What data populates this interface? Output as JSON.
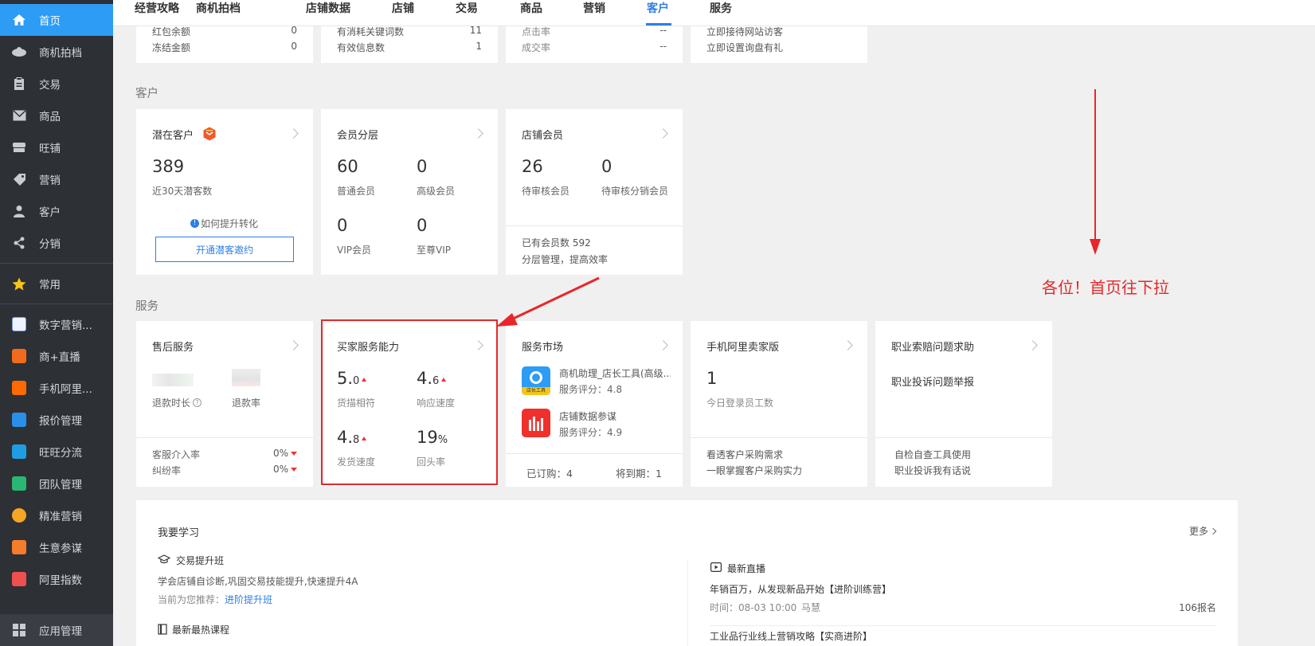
{
  "sidebar": {
    "items": [
      {
        "label": "首页",
        "icon": "home-icon"
      },
      {
        "label": "商机拍档",
        "icon": "handshake-icon"
      },
      {
        "label": "交易",
        "icon": "clipboard-icon"
      },
      {
        "label": "商品",
        "icon": "envelope-icon"
      },
      {
        "label": "旺铺",
        "icon": "store-icon"
      },
      {
        "label": "营销",
        "icon": "tag-icon"
      },
      {
        "label": "客户",
        "icon": "user-icon"
      },
      {
        "label": "分销",
        "icon": "network-icon"
      },
      {
        "label": "常用",
        "icon": "star-icon"
      },
      {
        "label": "数字营销...",
        "icon": "digital-marketing-icon"
      },
      {
        "label": "商+直播",
        "icon": "live-broadcast-icon"
      },
      {
        "label": "手机阿里...",
        "icon": "mobile-ali-icon"
      },
      {
        "label": "报价管理",
        "icon": "quote-icon"
      },
      {
        "label": "旺旺分流",
        "icon": "wangwang-icon"
      },
      {
        "label": "团队管理",
        "icon": "team-icon"
      },
      {
        "label": "精准营销",
        "icon": "target-icon"
      },
      {
        "label": "生意参谋",
        "icon": "compass-icon"
      },
      {
        "label": "阿里指数",
        "icon": "trend-icon"
      },
      {
        "label": "应用管理",
        "icon": "apps-grid-icon"
      }
    ]
  },
  "topnav": {
    "tabs": [
      "经营攻略",
      "商机拍档",
      "店铺数据",
      "店铺",
      "交易",
      "商品",
      "营销",
      "客户",
      "服务"
    ],
    "active": "客户"
  },
  "top_partial": {
    "c1": {
      "r1_label": "红包余额",
      "r1_value": "0",
      "r2_label": "冻结金额",
      "r2_value": "0"
    },
    "c2": {
      "r1_label": "有消耗关键词数",
      "r1_value": "11",
      "r2_label": "有效信息数",
      "r2_value": "1"
    },
    "c3": {
      "r1_label": "点击率",
      "r1_value": "--",
      "r2_label": "成交率",
      "r2_value": "--"
    },
    "c4": {
      "r1": "立即接待网站访客",
      "r2": "立即设置询盘有礼"
    }
  },
  "customer_section": {
    "title": "客户",
    "potential": {
      "title": "潜在客户",
      "value": "389",
      "label": "近30天潜客数",
      "hint": "如何提升转化",
      "button": "开通潜客邀约"
    },
    "member_tier": {
      "title": "会员分层",
      "items": [
        {
          "value": "60",
          "label": "普通会员"
        },
        {
          "value": "0",
          "label": "高级会员"
        },
        {
          "value": "0",
          "label": "VIP会员"
        },
        {
          "value": "0",
          "label": "至尊VIP"
        }
      ]
    },
    "shop_member": {
      "title": "店铺会员",
      "items": [
        {
          "value": "26",
          "label": "待审核会员"
        },
        {
          "value": "0",
          "label": "待审核分销会员"
        }
      ],
      "footer1": "已有会员数 592",
      "footer2": "分层管理，提高效率"
    }
  },
  "service_section": {
    "title": "服务",
    "after_sales": {
      "title": "售后服务",
      "label1": "退款时长",
      "label2": "退款率",
      "row1_label": "客服介入率",
      "row1_value": "0%",
      "row2_label": "纠纷率",
      "row2_value": "0%"
    },
    "buyer_service": {
      "title": "买家服务能力",
      "items": [
        {
          "main": "5.",
          "suffix": "0",
          "label": "货描相符"
        },
        {
          "main": "4.",
          "suffix": "6",
          "label": "响应速度"
        },
        {
          "main": "4.",
          "suffix": "8",
          "label": "发货速度"
        },
        {
          "main": "19",
          "suffix": "%",
          "label": "回头率"
        }
      ]
    },
    "market": {
      "title": "服务市场",
      "apps": [
        {
          "name": "商机助理_店长工具(高级...",
          "rating": "服务评分：4.8",
          "badge": "店长工具"
        },
        {
          "name": "店铺数据参谋",
          "rating": "服务评分：4.9"
        }
      ],
      "subscribed": "已订购：4",
      "expiring": "将到期：1"
    },
    "mobile_seller": {
      "title": "手机阿里卖家版",
      "value": "1",
      "label": "今日登录员工数",
      "footer1": "看透客户采购需求",
      "footer2": "一眼掌握客户采购实力"
    },
    "claims": {
      "title": "职业索赔问题求助",
      "body": "职业投诉问题举报",
      "footer1": "自检自查工具使用",
      "footer2": "职业投诉我有话说"
    }
  },
  "learn": {
    "title": "我要学习",
    "more": "更多",
    "course1": {
      "title": "交易提升班",
      "desc": "学会店铺自诊断,巩固交易技能提升,快速提升4A",
      "recommend_prefix": "当前为您推荐：",
      "recommend_link": "进阶提升班"
    },
    "course2": {
      "title": "最新最热课程"
    },
    "live": {
      "title": "最新直播",
      "item1": "年销百万，从发现新品开始【进阶训练营】",
      "item1_time": "时间：08-03 10:00",
      "item1_host": "马慧",
      "item1_count": "106报名",
      "item2": "工业品行业线上营销攻略【实商进阶】"
    }
  },
  "annotation": {
    "text": "各位！首页往下拉",
    "color": "#e8262a"
  },
  "colors": {
    "accent": "#2d7fe6",
    "sidebar_bg": "#2d3035",
    "sidebar_active": "#2d9cf4",
    "alert": "#e8262a"
  }
}
